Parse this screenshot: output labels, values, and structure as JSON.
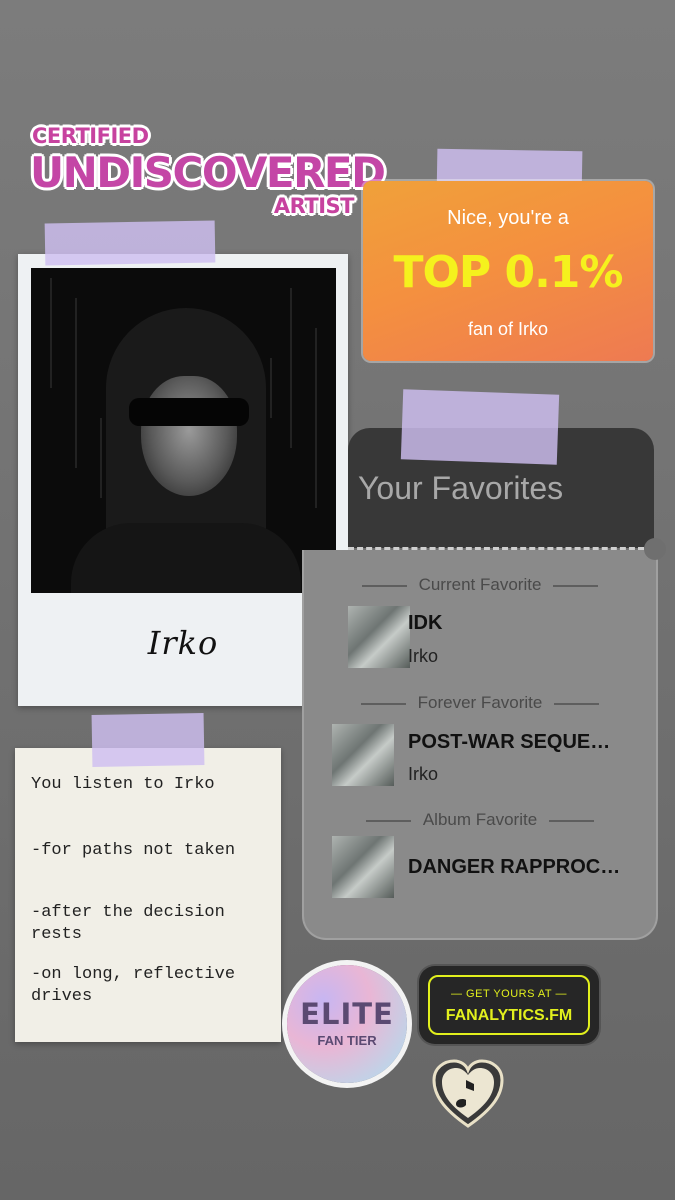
{
  "certified": {
    "top": "CERTIFIED",
    "main": "UNDISCOVERED",
    "bottom": "ARTIST"
  },
  "rank": {
    "line1": "Nice, you're a",
    "rank": "TOP 0.1%",
    "line3": "fan of Irko"
  },
  "polaroid": {
    "signature": "Irko"
  },
  "favorites": {
    "title": "Your Favorites",
    "current": {
      "label": "Current Favorite",
      "track": "IDK",
      "artist": "Irko"
    },
    "forever": {
      "label": "Forever Favorite",
      "track": "POST-WAR SEQUE…",
      "artist": "Irko"
    },
    "album": {
      "label": "Album Favorite",
      "title": "DANGER RAPPROC…"
    }
  },
  "note": {
    "lines": [
      "You listen to Irko",
      "-for paths not taken",
      "-after the decision rests",
      "-on long, reflective drives"
    ]
  },
  "elite": {
    "line1": "ELITE",
    "line2": "FAN TIER"
  },
  "promo": {
    "line1": "— GET YOURS AT —",
    "line2": "FANALYTICS.FM"
  },
  "colors": {
    "accent_pink": "#c446a6",
    "rank_yellow": "#f5f11d",
    "promo_lime": "#e2f01d",
    "tape": "#cebef0"
  },
  "icons": {
    "heart": "heart-music-note-icon"
  }
}
